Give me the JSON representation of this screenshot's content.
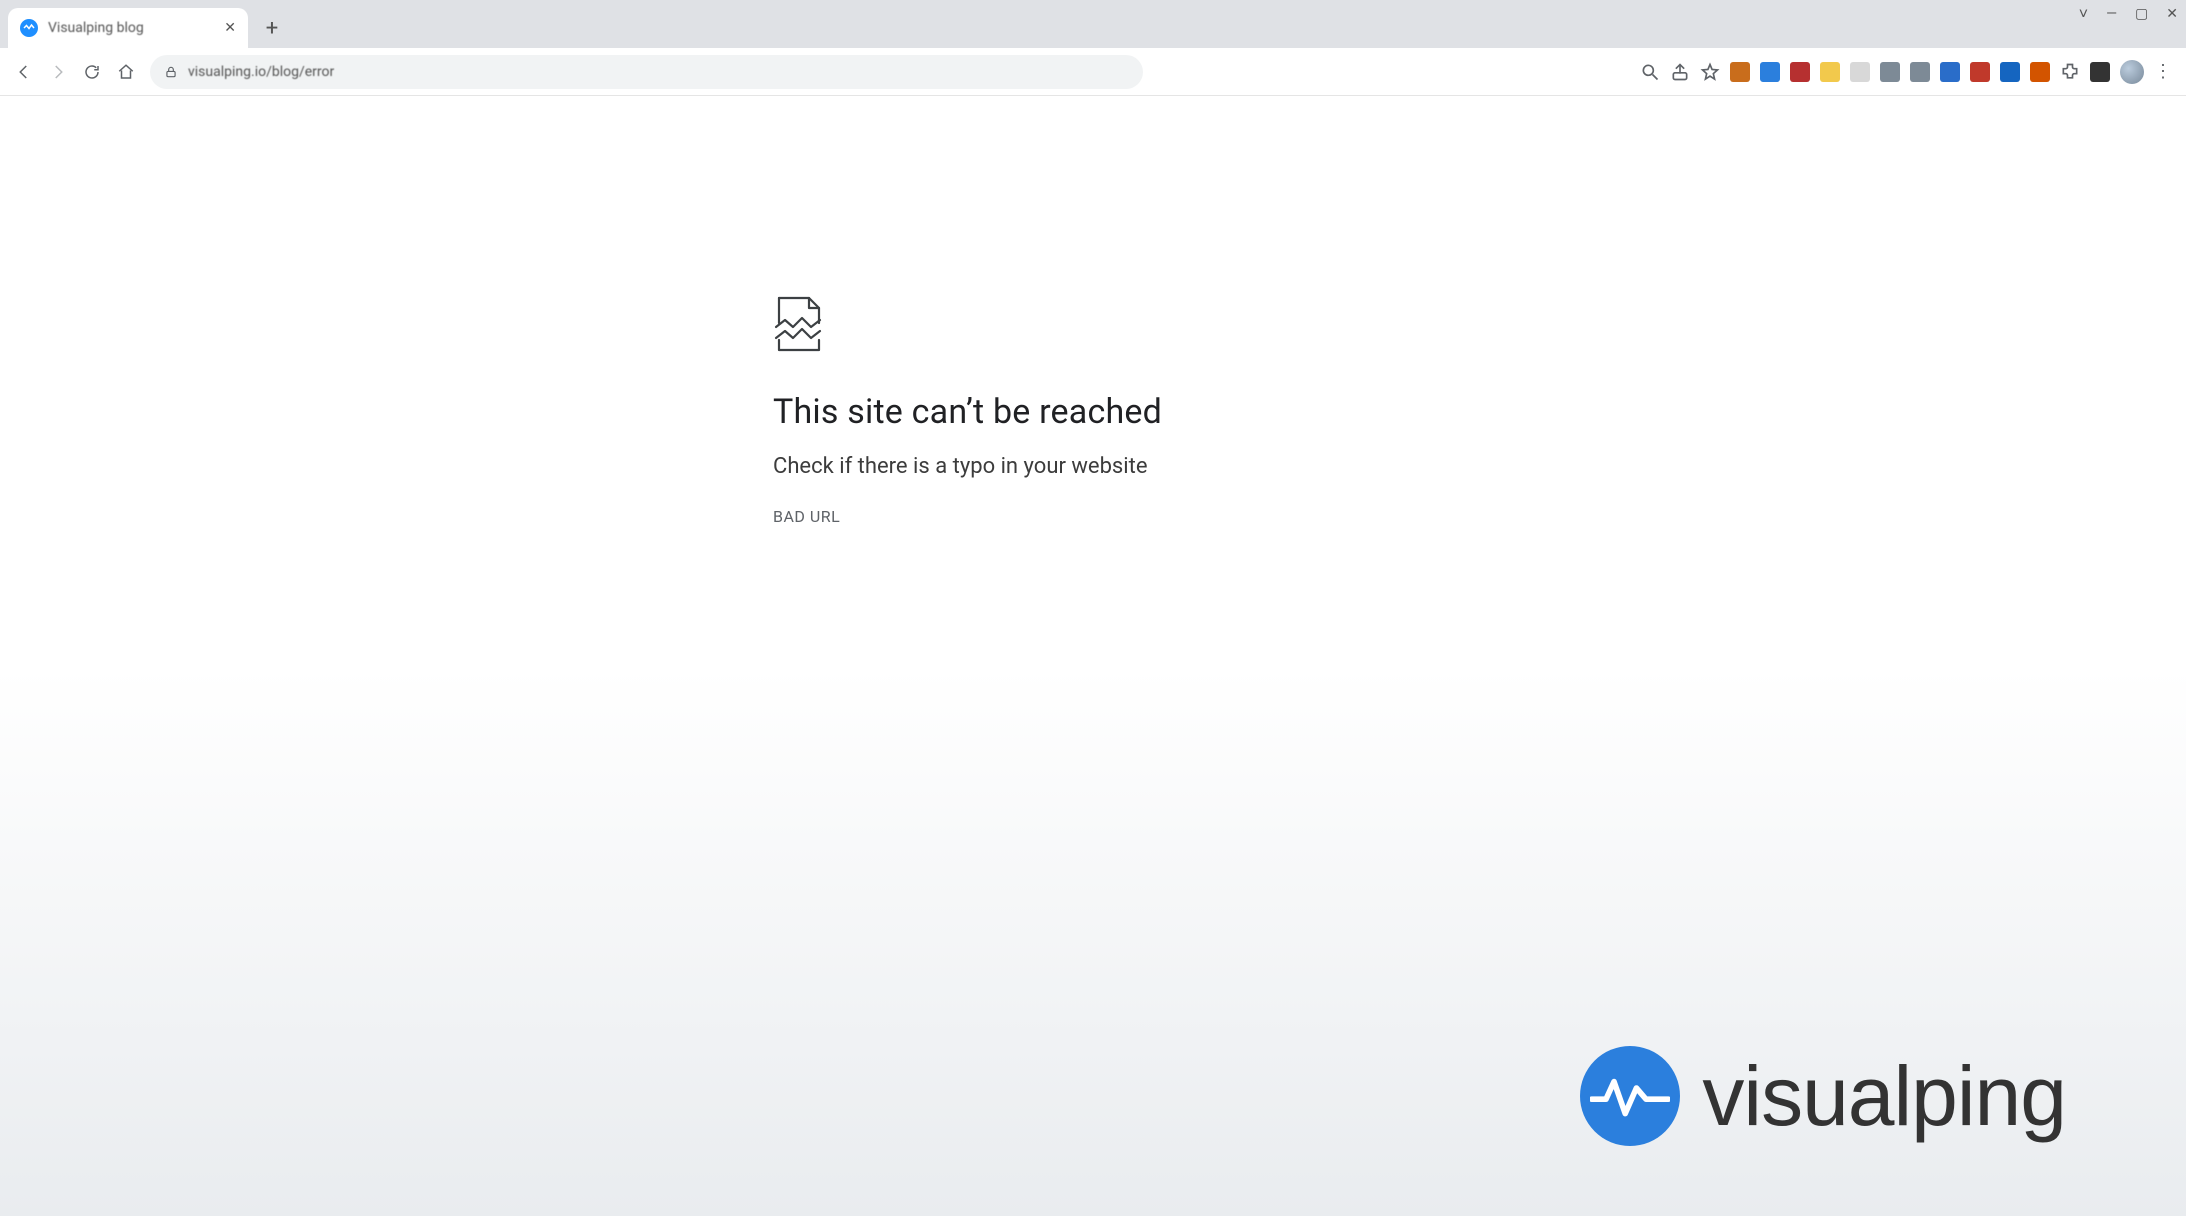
{
  "window": {
    "controls": {
      "chevron": "˅",
      "minimize": "—",
      "maximize": "▢",
      "close": "✕"
    }
  },
  "tab": {
    "title": "Visualping blog",
    "close": "✕"
  },
  "newTab": {
    "label": "+"
  },
  "toolbar": {
    "url": "visualping.io/blog/error"
  },
  "error": {
    "title": "This site can’t be reached",
    "subtitle": "Check if there is a typo in your website",
    "code": "BAD URL"
  },
  "overlay": {
    "brand": "visualping"
  },
  "extColors": {
    "a": "#c96d1c",
    "b": "#2b7fdd",
    "c": "#b63030",
    "d": "#f2c94c",
    "e": "#d8d8d8",
    "f": "#7d8a96",
    "g": "#7d8a96",
    "h": "#2a6dc9",
    "i": "#c0392b",
    "j": "#1565c0",
    "k": "#d35400",
    "l": "#333333",
    "m": "#333333"
  }
}
